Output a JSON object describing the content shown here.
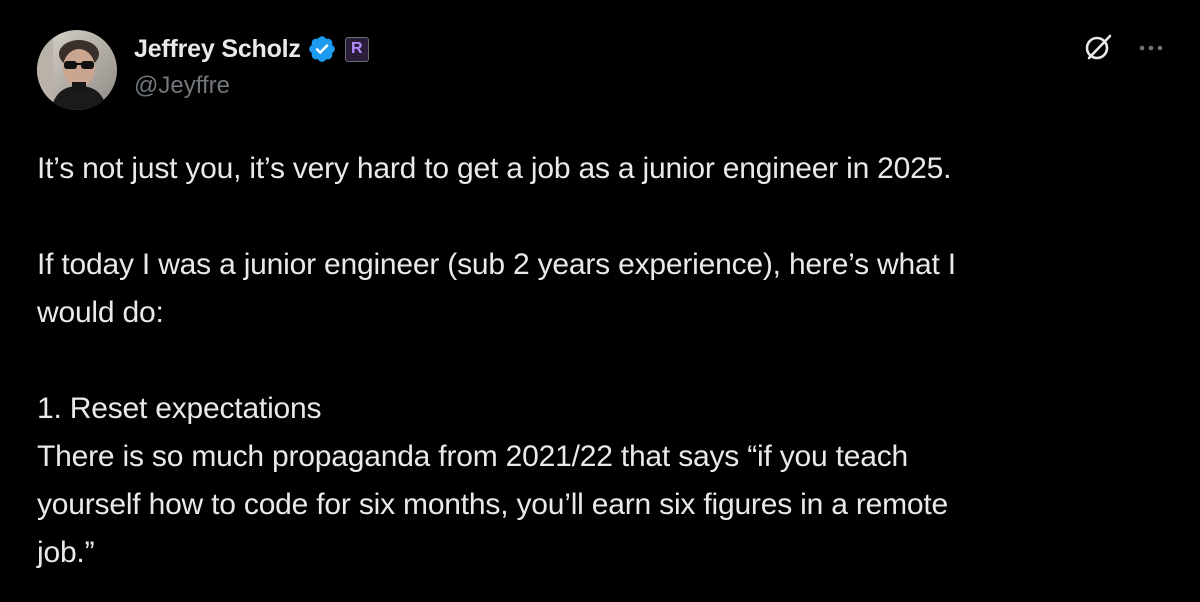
{
  "author": {
    "display_name": "Jeffrey Scholz",
    "handle": "@Jeyffre",
    "affiliate_badge": "R",
    "verified": true,
    "avatar_icon": "user-avatar-photo"
  },
  "actions": {
    "grok_icon": "grok-icon",
    "more_icon": "more-options-icon"
  },
  "tweet": {
    "para1": "It’s not just you, it’s very hard to get a job as a junior engineer in 2025.",
    "para2_line1": "If today I was a junior engineer (sub 2 years experience), here’s what I",
    "para2_line2": "would do:",
    "para3_heading": "1. Reset expectations",
    "para3_line1": "There is so much propaganda from 2021/22 that says “if you teach",
    "para3_line2": "yourself how to code for six months, you’ll earn six figures in a remote",
    "para3_line3": "job.”"
  },
  "colors": {
    "background": "#000000",
    "text_primary": "#e7e9ea",
    "text_secondary": "#71767b",
    "verified_blue": "#1d9bf0",
    "badge_purple": "#b38cff"
  }
}
